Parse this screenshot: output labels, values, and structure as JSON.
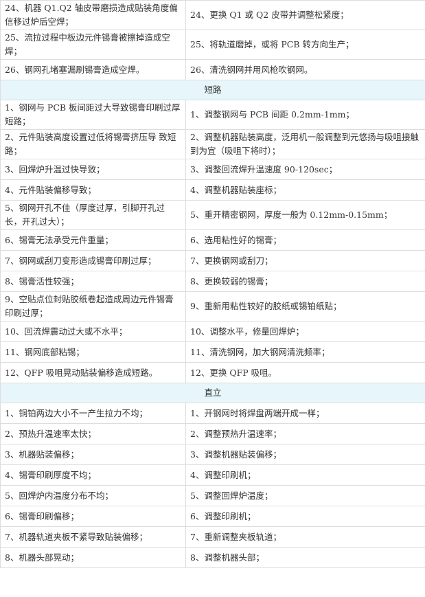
{
  "rows": [
    {
      "type": "row",
      "tall": true,
      "cause": "24、机器 Q1.Q2 轴皮带磨损造成贴装角度偏信移过炉后空焊；",
      "fix": "24、更换 Q1 或 Q2 皮带并调整松紧度；"
    },
    {
      "type": "row",
      "tall": true,
      "cause": "25、流拉过程中板边元件锡膏被擦掉造成空焊；",
      "fix": "25、将轨道磨掉，或将 PCB 转方向生产；"
    },
    {
      "type": "row",
      "cause": "26、钢网孔堵塞漏刷锡膏造成空焊。",
      "fix": "26、清洗钢网并用风枪吹钢网。"
    },
    {
      "type": "section",
      "title": "短路"
    },
    {
      "type": "row",
      "tall": true,
      "cause": "1、钢网与 PCB 板间距过大导致锡膏印刷过厚短路；",
      "fix": "1、调整钢网与 PCB 间距 0.2mm-1mm；"
    },
    {
      "type": "row",
      "tall": true,
      "cause": "2、元件贴装高度设置过低将锡膏挤压导 致短路；",
      "fix": "2、调整机器贴装高度，泛用机一般调整到元悠扬与吸咀接触到为宜（吸咀下将时）；"
    },
    {
      "type": "row",
      "cause": "3、回焊炉升温过快导致；",
      "fix": "3、调整回流焊升温速度 90-120sec；"
    },
    {
      "type": "row",
      "cause": "4、元件贴装偏移导致；",
      "fix": "4、调整机器贴装座标；"
    },
    {
      "type": "row",
      "tall": true,
      "cause": "5、钢网开孔不佳（厚度过厚，引脚开孔过长，开孔过大）；",
      "fix": "5、重开精密钢网，厚度一般为 0.12mm-0.15mm；"
    },
    {
      "type": "row",
      "cause": "6、锡膏无法承受元件重量；",
      "fix": "6、选用粘性好的锡膏；"
    },
    {
      "type": "row",
      "cause": "7、钢网或刮刀变形造成锡膏印刷过厚；",
      "fix": "7、更换钢网或刮刀；"
    },
    {
      "type": "row",
      "cause": "8、锡膏活性较强；",
      "fix": "8、更换较弱的锡膏；"
    },
    {
      "type": "row",
      "tall": true,
      "cause": "9、空贴点位封贴胶纸卷起造成周边元件锡膏印刷过厚；",
      "fix": "9、重新用粘性较好的胶纸或锡铂纸贴；"
    },
    {
      "type": "row",
      "cause": "10、回流焊震动过大或不水平；",
      "fix": "10、调整水平，修量回焊炉；"
    },
    {
      "type": "row",
      "cause": "11、钢网底部粘锡；",
      "fix": "11、清洗钢网，加大钢网清洗频率；"
    },
    {
      "type": "row",
      "cause": "12、QFP 吸咀晃动贴装偏移造成短路。",
      "fix": "12、更换 QFP 吸咀。"
    },
    {
      "type": "section",
      "title": "直立"
    },
    {
      "type": "row",
      "cause": "1、铜铂两边大小不一产生拉力不均；",
      "fix": "1、开钢网时将焊盘两端开成一样；"
    },
    {
      "type": "row",
      "cause": "2、预热升温速率太快；",
      "fix": "2、调整预热升温速率；"
    },
    {
      "type": "row",
      "cause": "3、机器贴装偏移；",
      "fix": "3、调整机器贴装偏移；"
    },
    {
      "type": "row",
      "cause": "4、锡膏印刷厚度不均；",
      "fix": "4、调整印刷机；"
    },
    {
      "type": "row",
      "cause": "5、回焊炉内温度分布不均；",
      "fix": "5、调整回焊炉温度；"
    },
    {
      "type": "row",
      "cause": "6、锡膏印刷偏移；",
      "fix": "6、调整印刷机；"
    },
    {
      "type": "row",
      "cause": "7、机器轨道夹板不紧导致贴装偏移；",
      "fix": "7、重新调整夹板轨道；"
    },
    {
      "type": "row",
      "cause": "8、机器头部晃动；",
      "fix": "8、调整机器头部；"
    }
  ]
}
